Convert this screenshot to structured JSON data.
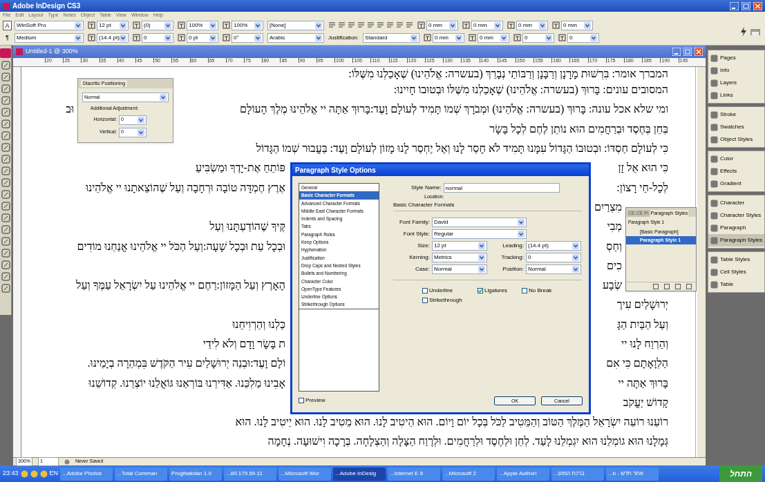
{
  "app_title": "Adobe InDesign CS3",
  "menu": [
    "File",
    "Edit",
    "Layout",
    "Type",
    "Notes",
    "Object",
    "Table",
    "View",
    "Window",
    "Help"
  ],
  "control_bar": {
    "modes": [
      {
        "label": "A",
        "selected": true
      },
      {
        "label": "¶",
        "selected": false
      }
    ],
    "row1": [
      {
        "kind": "font",
        "text": "WinSoft Pro"
      },
      {
        "kind": "spin",
        "text": "12 pt"
      },
      {
        "kind": "spin",
        "text": "(0)"
      },
      {
        "kind": "spin",
        "text": "100%"
      },
      {
        "kind": "spin",
        "text": "100%"
      },
      {
        "kind": "menu",
        "text": "[None]"
      },
      {
        "kind": "align"
      },
      {
        "kind": "spin",
        "text": "0 mm"
      },
      {
        "kind": "spin",
        "text": "0 mm"
      },
      {
        "kind": "spin",
        "text": "0 mm"
      },
      {
        "kind": "spin",
        "text": "0 mm"
      }
    ],
    "row2": [
      {
        "kind": "font",
        "text": "Medium"
      },
      {
        "kind": "spin",
        "text": "(14.4 pt)"
      },
      {
        "kind": "spin",
        "text": "0"
      },
      {
        "kind": "spin",
        "text": "0 pt"
      },
      {
        "kind": "spin",
        "text": "0°"
      },
      {
        "kind": "menu",
        "text": "Arabic"
      },
      {
        "kind": "label",
        "text": "Justification:"
      },
      {
        "kind": "menu",
        "text": "Standard"
      },
      {
        "kind": "spin",
        "text": "0 mm"
      },
      {
        "kind": "spin",
        "text": "0 mm"
      },
      {
        "kind": "spin",
        "text": "0"
      },
      {
        "kind": "spin",
        "text": "0"
      }
    ]
  },
  "document": {
    "title": "Untitled-1 @ 300%",
    "ruler": [
      "20",
      "25",
      "30",
      "35",
      "40",
      "45",
      "50",
      "55",
      "60",
      "65",
      "70",
      "75",
      "80",
      "85",
      "90",
      "95",
      "100",
      "105",
      "110",
      "115",
      "120",
      "125",
      "130",
      "135",
      "140",
      "145",
      "150",
      "155",
      "160",
      "165",
      "170",
      "175",
      "180",
      "185",
      "190",
      "195"
    ],
    "lines": [
      {
        "kind": "full",
        "text": "המברך אומר: בִּרְשׁוּת מָרָנָן וְרַבָּנָן וְרַבּוֹתַי נְבָרֵךְ (בעשרה: אֱלֹהֵינוּ) שֶׁאָכַלְנוּ מִשֶּׁלּוֹ:"
      },
      {
        "kind": "full",
        "text": "המסובים עונים: בָּרוּךְ (בעשרה: אֱלֹהֵינוּ) שֶׁאָכַלְנוּ מִשֶּׁלּוֹ וּבְטוּבוֹ חָיִינוּ:"
      },
      {
        "kind": "around_panel",
        "right": "ומי שלא אכל עונה: בָּרוּךְ (בעשרה: אֱלֹהֵינוּ) וּמְבֹרָךְ שְׁמוֹ תָּמִיד לְעוֹלָם וָעֶד:בָּרוּךְ אַתָּה יי אֱלֹהֵינוּ מֶלֶךְ הָעוֹלָם",
        "left": "וּב"
      },
      {
        "kind": "full",
        "text": "בְּחֵן בְּחֶסֶד וּבְרַחֲמִים הוּא נוֹתֵן לֶחֶם לְכָל בָּשָׂר"
      },
      {
        "kind": "full",
        "text": "כִּי לְעוֹלָם חַסְדּוֹ: וּבְטוּבוֹ הַגָּדוֹל עִמָּנוּ תָּמִיד לֹא חָסַר לָנוּ וְאַל יֶחְסַר לָנוּ מָזוֹן לְעוֹלָם וָעֶד: בַּעֲבוּר שְׁמוֹ הַגָּדוֹל"
      },
      {
        "kind": "around_dialog",
        "right": "כִּי הוּא אֵל זָן",
        "left": "פּוֹתֵחַ אֶת-יָדֶךָ וּמַשְׂבִּיעַ"
      },
      {
        "kind": "around_dialog",
        "right": "לְכָל-חַי רָצוֹן:",
        "left": "אֶרֶץ חֶמְדָּה טוֹבָה וּרְחָבָה וְעַל שֶׁהוֹצֵאתָנוּ יי אֱלֹהֵינוּ"
      },
      {
        "kind": "around_both",
        "right": "מִצְרַיִם"
      },
      {
        "kind": "around_both",
        "right": "מְבִי",
        "left": "קֶּיךָ שֶׁהוֹדַעְתָּנוּ וְעַל"
      },
      {
        "kind": "around_both",
        "right": "וְחַסְ",
        "left": "וּבְכָל עֵת וּבְכָל שָׁעָה:וְעַל הַכֹּל יי אֱלֹהֵינוּ אֲנַחְנוּ מוֹדִים"
      },
      {
        "kind": "around_both",
        "right": "כִים"
      },
      {
        "kind": "around_both",
        "right": "שְׂבָע",
        "left": "הָאָרֶץ וְעַל הַמָּזוֹן:רַחֶם יי אֱלֹהֵינוּ עַל יִשְׂרָאֵל עַמֶּךָ וְעַל"
      },
      {
        "kind": "around_dialog",
        "right": "יְרוּשָׁלַיִם עִירֶ"
      },
      {
        "kind": "around_dialog",
        "right": "וְעַל הַבַּיִת הַגָּ",
        "left": "כַּלְנוּ וְהַרְוִיחֵנוּ"
      },
      {
        "kind": "around_dialog",
        "right": "וְהַרְוַח לָנוּ יי",
        "left": "ת בָּשָׂר וָדָם וְלֹא לִידֵי"
      },
      {
        "kind": "around_dialog",
        "right": "הַלְוָאָתָם כִּי אִם",
        "left": "וֹלָם וָעֶד:וּבְנֵה יְרוּשָׁלַיִם עִיר הַקֹּדֶשׁ בִּמְהֵרָה בְיָמֵינוּ."
      },
      {
        "kind": "around_dialog",
        "right": "בָּרוּךְ אַתָּה יי",
        "left": "אָבִינוּ מַלְכֵּנוּ. אַדִּירֵנוּ בּוֹרְאֵנוּ גּוֹאֲלֵנוּ יוֹצְרֵנוּ. קְדוֹשֵׁנוּ"
      },
      {
        "kind": "around_dialog",
        "right": "קָדוֹשׁ יַעֲקֹב"
      },
      {
        "kind": "full",
        "text": "רוֹעֵנוּ רוֹעֵה יִשְׂרָאֵל הַמֶּלֶךְ הַטּוֹב וְהַמֵּטִיב לַכֹּל בְּכָל יוֹם וָיוֹם. הוּא הֵיטִיב לָנוּ. הוּא מֵטִיב לָנוּ. הוּא יֵיטִיב לָנוּ. הוּא"
      },
      {
        "kind": "full",
        "text": "גְּמָלָנוּ הוּא גוֹמְלֵנוּ הוּא יִגְמְלֵנוּ לָעַד. לְחֵן וּלְחֶסֶד וּלְרַחֲמִים. וּלְרֶוַח הַצָּלָה וְהַצְלָחָה. בְּרָכָה וִישׁוּעָה. נֶחָמָה"
      }
    ],
    "zoom": "300%",
    "page": "1",
    "save_state": "Never Saved"
  },
  "diacritic_panel": {
    "tab": "Diacritic Positioning",
    "mode": "Normal",
    "adjustment_label": "Additional Adjustment:",
    "fields": [
      {
        "label": "Horizontal:",
        "value": "0"
      },
      {
        "label": "Vertical:",
        "value": "0"
      }
    ]
  },
  "dialog": {
    "title": "Paragraph Style Options",
    "categories": [
      {
        "label": "General",
        "selected": false
      },
      {
        "label": "Basic Character Formats",
        "selected": true
      },
      {
        "label": "Advanced Character Formats",
        "selected": false
      },
      {
        "label": "Middle East Character Formats",
        "selected": false
      },
      {
        "label": "Indents and Spacing",
        "selected": false
      },
      {
        "label": "Tabs",
        "selected": false
      },
      {
        "label": "Paragraph Rules",
        "selected": false
      },
      {
        "label": "Keep Options",
        "selected": false
      },
      {
        "label": "Hyphenation",
        "selected": false
      },
      {
        "label": "Justification",
        "selected": false
      },
      {
        "label": "Drop Caps and Nested Styles",
        "selected": false
      },
      {
        "label": "Bullets and Numbering",
        "selected": false
      },
      {
        "label": "Character Color",
        "selected": false
      },
      {
        "label": "OpenType Features",
        "selected": false
      },
      {
        "label": "Underline Options",
        "selected": false
      },
      {
        "label": "Strikethrough Options",
        "selected": false
      }
    ],
    "style_name_label": "Style Name:",
    "style_name": "normal",
    "location_label": "Location:",
    "section": "Basic Character Formats",
    "field_rows": [
      [
        {
          "label": "Font Family:",
          "value": "David"
        }
      ],
      [
        {
          "label": "Font Style:",
          "value": "Regular"
        }
      ],
      [
        {
          "label": "Size:",
          "value": "12 pt"
        },
        {
          "label": "Leading:",
          "value": "(14.4 pt)"
        }
      ],
      [
        {
          "label": "Kerning:",
          "value": "Metrics"
        },
        {
          "label": "Tracking:",
          "value": "0"
        }
      ],
      [
        {
          "label": "Case:",
          "value": "Normal"
        },
        {
          "label": "Position:",
          "value": "Normal"
        }
      ]
    ],
    "checkboxes": [
      {
        "label": "Underline",
        "checked": false
      },
      {
        "label": "Ligatures",
        "checked": true
      },
      {
        "label": "No Break",
        "checked": false
      },
      {
        "label": "Strikethrough",
        "checked": false
      }
    ],
    "preview": {
      "label": "Preview",
      "checked": false
    },
    "buttons": [
      "OK",
      "Cancel"
    ]
  },
  "styles_panel": {
    "tabs": [
      {
        "label": "CE CE Pi",
        "selected": false
      },
      {
        "label": "Paragraph Styles",
        "selected": true
      }
    ],
    "current": "Paragraph Style 1",
    "styles": [
      {
        "label": "[Basic Paragraph]",
        "selected": false
      },
      {
        "label": "Paragraph Style 1",
        "selected": true
      }
    ]
  },
  "dock": [
    [
      {
        "label": "Pages",
        "selected": false
      },
      {
        "label": "Info",
        "selected": false
      },
      {
        "label": "Layers",
        "selected": false
      },
      {
        "label": "Links",
        "selected": false
      }
    ],
    [
      {
        "label": "Stroke",
        "selected": false
      },
      {
        "label": "Swatches",
        "selected": false
      },
      {
        "label": "Object Styles",
        "selected": false
      }
    ],
    [
      {
        "label": "Color",
        "selected": false
      },
      {
        "label": "Effects",
        "selected": false
      },
      {
        "label": "Gradient",
        "selected": false
      }
    ],
    [
      {
        "label": "Character",
        "selected": false
      },
      {
        "label": "Character Styles",
        "selected": false
      },
      {
        "label": "Paragraph",
        "selected": false
      },
      {
        "label": "Paragraph Styles",
        "selected": true
      }
    ],
    [
      {
        "label": "Table Styles",
        "selected": false
      },
      {
        "label": "Cell Styles",
        "selected": false
      },
      {
        "label": "Table",
        "selected": false
      }
    ]
  ],
  "taskbar": {
    "clock": "23:43",
    "language": "EN",
    "tasks": [
      {
        "label": "...Adobe Photos",
        "selected": false
      },
      {
        "label": "...Total Comman",
        "selected": false
      },
      {
        "label": "ProgNakdan 1.0",
        "selected": false
      },
      {
        "label": "...80.179.59.11",
        "selected": false
      },
      {
        "label": "...Microsoft Wor",
        "selected": false
      },
      {
        "label": "...Adobe InDesig",
        "selected": true
      },
      {
        "label": "...Internet E 6",
        "selected": false
      },
      {
        "label": "...Microsoft 2",
        "selected": false
      },
      {
        "label": "...Apple Authori",
        "selected": false
      },
      {
        "label": "...ברכת המזון",
        "selected": false
      },
      {
        "label": "...b - אתר חדש",
        "selected": false
      }
    ],
    "start": "התחל"
  }
}
